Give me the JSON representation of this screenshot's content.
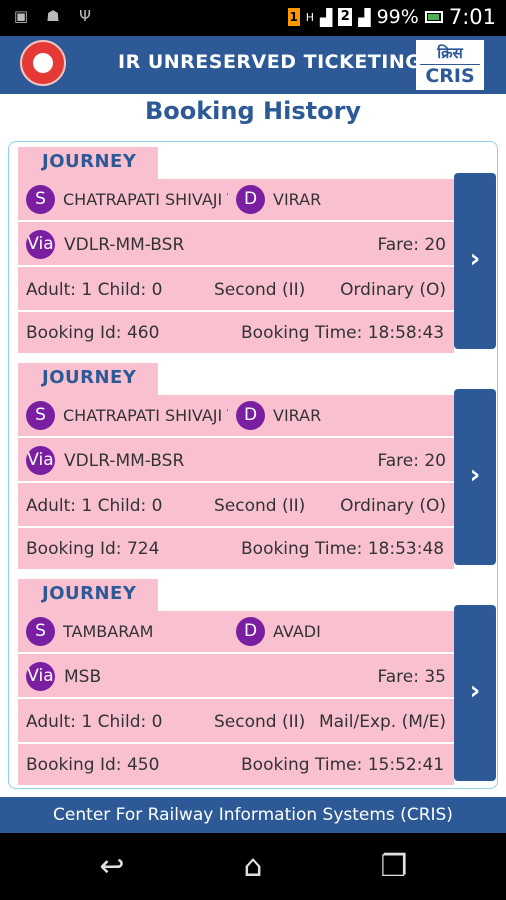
{
  "status_bar": {
    "left_icons": [
      "image-icon",
      "android-icon",
      "usb-icon"
    ],
    "sim1_label": "1",
    "signal_type": "H",
    "sim2_label": "2",
    "battery": "99%",
    "time": "7:01"
  },
  "header": {
    "title": "IR UNRESERVED TICKETING",
    "cris_hindi": "क्रिस",
    "cris_label": "CRIS"
  },
  "page_title": "Booking History",
  "bookings": [
    {
      "journey_label": "JOURNEY",
      "source_badge": "S",
      "source": "CHATRAPATI SHIVAJI T",
      "dest_badge": "D",
      "dest": "VIRAR",
      "via_badge": "Via",
      "via": "VDLR-MM-BSR",
      "fare": "Fare: 20",
      "passengers": "Adult: 1 Child: 0",
      "class": "Second (II)",
      "ticket_type": "Ordinary (O)",
      "booking_id": "Booking Id: 460",
      "booking_time": "Booking Time:  18:58:43"
    },
    {
      "journey_label": "JOURNEY",
      "source_badge": "S",
      "source": "CHATRAPATI SHIVAJI T",
      "dest_badge": "D",
      "dest": "VIRAR",
      "via_badge": "Via",
      "via": "VDLR-MM-BSR",
      "fare": "Fare: 20",
      "passengers": "Adult: 1 Child: 0",
      "class": "Second (II)",
      "ticket_type": "Ordinary (O)",
      "booking_id": "Booking Id: 724",
      "booking_time": "Booking Time:  18:53:48"
    },
    {
      "journey_label": "JOURNEY",
      "source_badge": "S",
      "source": "TAMBARAM",
      "dest_badge": "D",
      "dest": "AVADI",
      "via_badge": "Via",
      "via": "MSB",
      "fare": "Fare: 35",
      "passengers": "Adult: 1 Child: 0",
      "class": "Second (II)",
      "ticket_type": "Mail/Exp. (M/E)",
      "booking_id": "Booking Id: 450",
      "booking_time": "Booking Time:  15:52:41"
    }
  ],
  "arrow_glyph": "›",
  "footer": "Center For Railway Information Systems (CRIS)",
  "navbar": {
    "back_glyph": "↩",
    "home_glyph": "⌂",
    "recents_glyph": "❐"
  },
  "colors": {
    "primary": "#2d5a96",
    "card_pink": "#f9c1cf",
    "badge_purple": "#7b1fa2",
    "container_border": "#8ecfea"
  }
}
